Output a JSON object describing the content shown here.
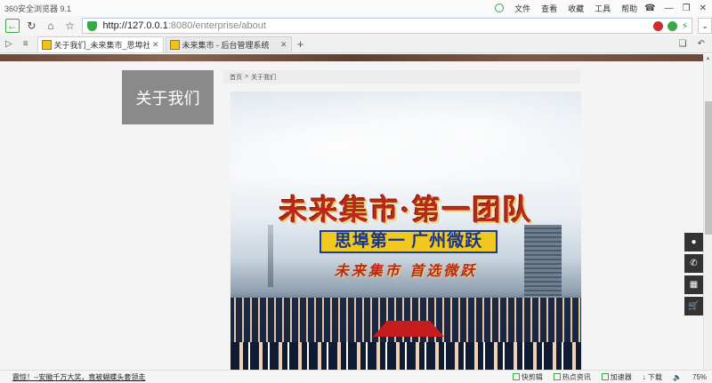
{
  "browser": {
    "app_title": "360安全浏览器 9.1",
    "menu": [
      "文件",
      "查看",
      "收藏",
      "工具",
      "帮助"
    ],
    "url_host": "http://127.0.0.1",
    "url_rest": ":8080/enterprise/about",
    "tabs": [
      {
        "label": "关于我们_未来集市_思埠社交电商",
        "active": true
      },
      {
        "label": "未来集市 - 后台管理系统",
        "active": false
      }
    ]
  },
  "page": {
    "side_title": "关于我们",
    "breadcrumb": {
      "home": "首页",
      "separator": ">",
      "current": "关于我们"
    },
    "banner": {
      "headline": "未来集市·第一团队",
      "bar_text": "思埠第一 广州微跃",
      "subline": "未来集市 首选微跃"
    }
  },
  "statusbar": {
    "news": "震惊！--安徽千万大奖，竟被蝴蝶头套领走",
    "items": [
      "快剪辑",
      "热点资讯",
      "加速器",
      "下载"
    ],
    "zoom": "75%"
  },
  "colors": {
    "accent_green": "#3aa845",
    "headline_red": "#b8291a"
  }
}
